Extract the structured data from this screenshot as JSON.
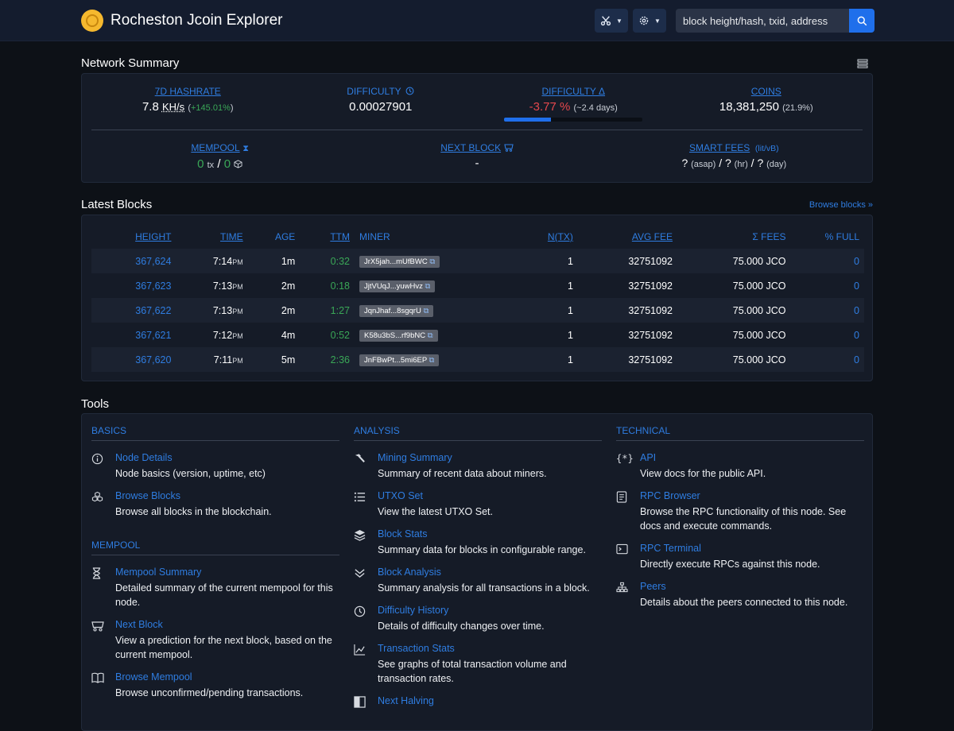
{
  "navbar": {
    "brand_title": "Rocheston Jcoin Explorer",
    "search_placeholder": "block height/hash, txid, address"
  },
  "summary": {
    "title": "Network Summary",
    "hashrate": {
      "label": "7D HASHRATE",
      "value": "7.8",
      "unit": "KH/s",
      "change": "+145.01%"
    },
    "difficulty": {
      "label": "DIFFICULTY",
      "value": "0.00027901"
    },
    "difficulty_delta": {
      "label": "DIFFICULTY Δ",
      "value": "-3.77 %",
      "eta": "(~2.4 days)",
      "progress": 0.34
    },
    "coins": {
      "label": "COINS",
      "value": "18,381,250",
      "pct": "(21.9%)"
    },
    "mempool": {
      "label": "MEMPOOL",
      "tx_count": "0",
      "tx_unit": "tx",
      "sep": "/",
      "size": "0"
    },
    "next_block": {
      "label": "NEXT BLOCK",
      "value": "-"
    },
    "smart_fees": {
      "label": "SMART FEES",
      "unit": "(lit/vB)",
      "asap_val": "?",
      "asap": "(asap)",
      "hr_val": "?",
      "hr": "(hr)",
      "day_val": "?",
      "day": "(day)",
      "sep": "/"
    }
  },
  "latest_blocks": {
    "title": "Latest Blocks",
    "browse_link": "Browse blocks »",
    "columns": [
      "HEIGHT",
      "TIME",
      "AGE",
      "TTM",
      "MINER",
      "N(TX)",
      "AVG FEE",
      "Σ FEES",
      "% FULL"
    ],
    "rows": [
      {
        "height": "367,624",
        "time": "7:14",
        "ampm": "PM",
        "age": "1m",
        "ttm": "0:32",
        "miner": "JrX5jah...mUfBWC",
        "ntx": "1",
        "avg_fee": "32751092",
        "fees": "75.000 JCO",
        "full": "0"
      },
      {
        "height": "367,623",
        "time": "7:13",
        "ampm": "PM",
        "age": "2m",
        "ttm": "0:18",
        "miner": "JjtVUqJ...yuwHvz",
        "ntx": "1",
        "avg_fee": "32751092",
        "fees": "75.000 JCO",
        "full": "0"
      },
      {
        "height": "367,622",
        "time": "7:13",
        "ampm": "PM",
        "age": "2m",
        "ttm": "1:27",
        "miner": "JqnJhaf...8sgqrU",
        "ntx": "1",
        "avg_fee": "32751092",
        "fees": "75.000 JCO",
        "full": "0"
      },
      {
        "height": "367,621",
        "time": "7:12",
        "ampm": "PM",
        "age": "4m",
        "ttm": "0:52",
        "miner": "K58u3bS...rf9bNC",
        "ntx": "1",
        "avg_fee": "32751092",
        "fees": "75.000 JCO",
        "full": "0"
      },
      {
        "height": "367,620",
        "time": "7:11",
        "ampm": "PM",
        "age": "5m",
        "ttm": "2:36",
        "miner": "JnFBwPt...5mi6EP",
        "ntx": "1",
        "avg_fee": "32751092",
        "fees": "75.000 JCO",
        "full": "0"
      }
    ]
  },
  "tools": {
    "title": "Tools",
    "basics": {
      "heading": "BASICS",
      "items": [
        {
          "name": "Node Details",
          "desc": "Node basics (version, uptime, etc)",
          "icon": "info-icon"
        },
        {
          "name": "Browse Blocks",
          "desc": "Browse all blocks in the blockchain.",
          "icon": "boxes-icon"
        }
      ]
    },
    "mempool": {
      "heading": "MEMPOOL",
      "items": [
        {
          "name": "Mempool Summary",
          "desc": "Detailed summary of the current mempool for this node.",
          "icon": "hourglass-icon"
        },
        {
          "name": "Next Block",
          "desc": "View a prediction for the next block, based on the current mempool.",
          "icon": "minecart-icon"
        },
        {
          "name": "Browse Mempool",
          "desc": "Browse unconfirmed/pending transactions.",
          "icon": "book-icon"
        }
      ]
    },
    "analysis": {
      "heading": "ANALYSIS",
      "items": [
        {
          "name": "Mining Summary",
          "desc": "Summary of recent data about miners.",
          "icon": "hammer-icon"
        },
        {
          "name": "UTXO Set",
          "desc": "View the latest UTXO Set.",
          "icon": "list-icon"
        },
        {
          "name": "Block Stats",
          "desc": "Summary data for blocks in configurable range.",
          "icon": "layers-icon"
        },
        {
          "name": "Block Analysis",
          "desc": "Summary analysis for all transactions in a block.",
          "icon": "chevrons-down-icon"
        },
        {
          "name": "Difficulty History",
          "desc": "Details of difficulty changes over time.",
          "icon": "clock-icon"
        },
        {
          "name": "Transaction Stats",
          "desc": "See graphs of total transaction volume and transaction rates.",
          "icon": "chart-icon"
        },
        {
          "name": "Next Halving",
          "desc": "",
          "icon": "halving-icon"
        }
      ]
    },
    "technical": {
      "heading": "TECHNICAL",
      "items": [
        {
          "name": "API",
          "desc": "View docs for the public API.",
          "icon": "api-icon"
        },
        {
          "name": "RPC Browser",
          "desc": "Browse the RPC functionality of this node. See docs and execute commands.",
          "icon": "document-icon"
        },
        {
          "name": "RPC Terminal",
          "desc": "Directly execute RPCs against this node.",
          "icon": "terminal-icon"
        },
        {
          "name": "Peers",
          "desc": "Details about the peers connected to this node.",
          "icon": "network-icon"
        }
      ]
    }
  }
}
